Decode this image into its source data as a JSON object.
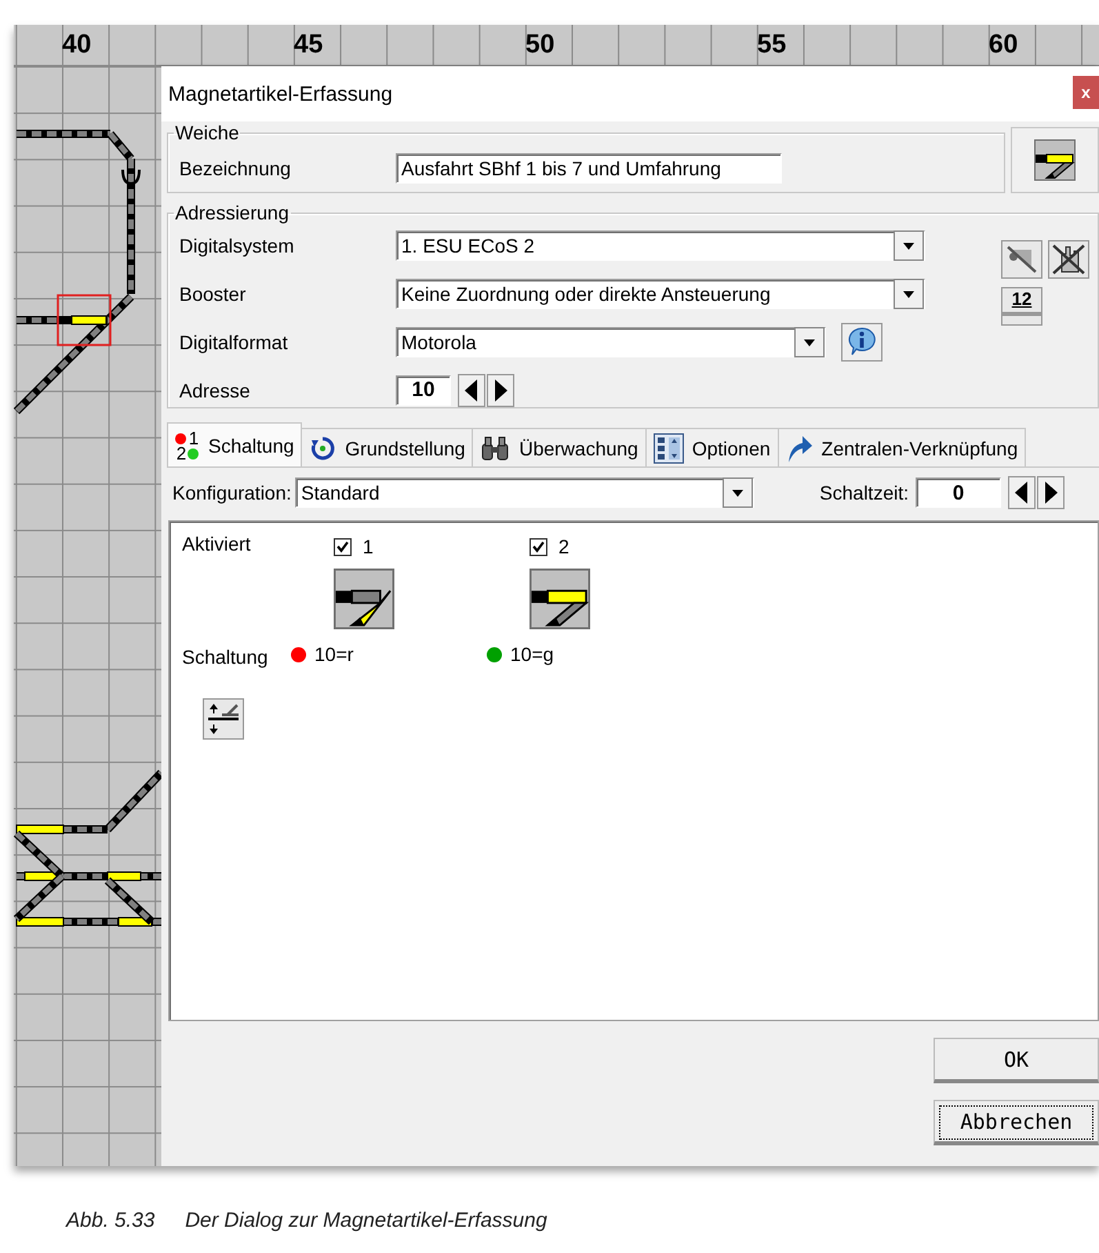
{
  "canvas": {
    "ruler": [
      "40",
      "45",
      "50",
      "55",
      "60"
    ]
  },
  "dialog": {
    "title": "Magnetartikel-Erfassung",
    "close": "x",
    "turnout_diverging": false,
    "weiche": {
      "legend": "Weiche",
      "label": "Bezeichnung",
      "value": "Ausfahrt SBhf 1 bis 7 und Umfahrung"
    },
    "adressierung": {
      "legend": "Adressierung",
      "fields": [
        {
          "label": "Digitalsystem",
          "kind": "select",
          "value": "1. ESU ECoS 2"
        },
        {
          "label": "Booster",
          "kind": "select",
          "value": "Keine Zuordnung oder direkte Ansteuerung"
        },
        {
          "label": "Digitalformat",
          "kind": "select-info",
          "value": "Motorola"
        },
        {
          "label": "Adresse",
          "kind": "spinner",
          "value": "10"
        }
      ],
      "counter_button": "12"
    },
    "tabs": [
      {
        "label": "Schaltung",
        "kind": "numbers",
        "icon_digits": [
          "1",
          "2"
        ],
        "selected": true
      },
      {
        "label": "Grundstellung",
        "kind": "reset",
        "selected": false
      },
      {
        "label": "Überwachung",
        "kind": "binoculars",
        "selected": false
      },
      {
        "label": "Optionen",
        "kind": "options",
        "selected": false
      },
      {
        "label": "Zentralen-Verknüpfung",
        "kind": "link",
        "selected": false
      }
    ],
    "config": {
      "label": "Konfiguration:",
      "value": "Standard",
      "time_label": "Schaltzeit:",
      "time_value": "0"
    },
    "panel": {
      "activated_label": "Aktiviert",
      "switching_label": "Schaltung",
      "outputs": [
        {
          "label": "1",
          "checked": true,
          "diverging": true,
          "address": "10=r",
          "color": "#ff0000"
        },
        {
          "label": "2",
          "checked": true,
          "diverging": false,
          "address": "10=g",
          "color": "#00a000"
        }
      ]
    },
    "buttons": [
      {
        "label": "OK",
        "focused": false
      },
      {
        "label": "Abbrechen",
        "focused": true
      }
    ]
  },
  "caption": {
    "number": "Abb. 5.33",
    "text": "Der Dialog zur Magnetartikel-Erfassung"
  }
}
